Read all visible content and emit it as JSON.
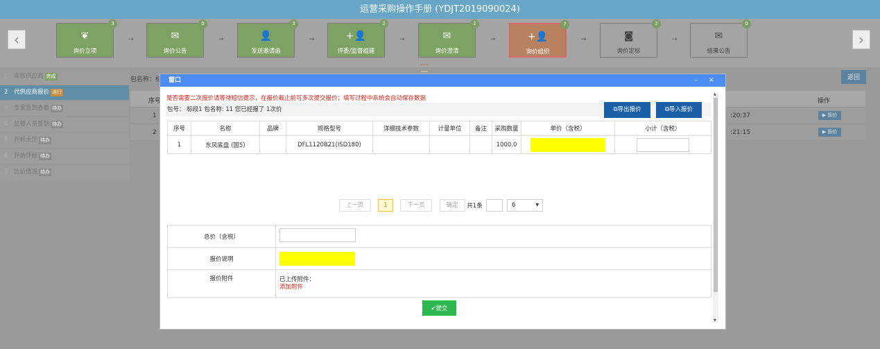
{
  "title": "运营采购操作手册 (YDJT2019090024)",
  "nav": {
    "prev_arrow": "‹",
    "next_arrow": "›",
    "step_separator": "→"
  },
  "steps": [
    {
      "label": "询价立项",
      "badge": "3",
      "color": "#7ea164",
      "icon": "leaf-icon",
      "glyph": "❦"
    },
    {
      "label": "询价公告",
      "badge": "0",
      "color": "#7ea164",
      "icon": "envelope-icon",
      "glyph": "✉"
    },
    {
      "label": "发送邀请函",
      "badge": "3",
      "color": "#7ea164",
      "icon": "user-icon",
      "glyph": "👤"
    },
    {
      "label": "评委/监督组建",
      "badge": "2",
      "color": "#7ea164",
      "icon": "user-plus-icon",
      "glyph": "+👤"
    },
    {
      "label": "询价澄清",
      "badge": "2",
      "color": "#7ea164",
      "icon": "envelope-icon",
      "glyph": "✉"
    },
    {
      "label": "询价组织",
      "badge": "7",
      "color": "#b88260",
      "icon": "user-plus-icon",
      "glyph": "+👤",
      "active": true
    },
    {
      "label": "询价定标",
      "badge": "2",
      "color": "#a4a4a4",
      "icon": "camera-icon",
      "glyph": "◙"
    },
    {
      "label": "结果公告",
      "badge": "0",
      "color": "#a4a4a4",
      "icon": "envelope-icon",
      "glyph": "✉"
    }
  ],
  "sidebar": [
    {
      "num": "1",
      "label": "审核供应商",
      "status": "完成",
      "status_color": "#7ea164"
    },
    {
      "num": "2",
      "label": "代供应商报价",
      "status": "进行",
      "status_color": "#c88a3a",
      "active": true
    },
    {
      "num": "3",
      "label": "专家签到查看",
      "status": "待办"
    },
    {
      "num": "4",
      "label": "监督人员签到",
      "status": "待办"
    },
    {
      "num": "5",
      "label": "开标大厅",
      "status": "待办"
    },
    {
      "num": "6",
      "label": "开始评标",
      "status": "待办"
    },
    {
      "num": "7",
      "label": "比价情况",
      "status": "待办"
    }
  ],
  "background": {
    "package_label": "包名称：标",
    "back_button": "返回",
    "header_no": "序号",
    "header_op": "操作",
    "rows": [
      {
        "no": "1",
        "time": ":20:37",
        "op": "▶ 报价"
      },
      {
        "no": "2",
        "time": ":21:15",
        "op": "▶ 报价"
      }
    ]
  },
  "dialog": {
    "title": "窗口",
    "minimize": "–",
    "close": "×",
    "warning": "是否需要二次报价请等待短信提示，在报价截止前可多次提交报价；填写过程中系统会自动保存数据",
    "info": "包号：   标段1   包名称: 11   您已经报了 1次价",
    "export_button": "⧉导出报价",
    "import_button": "⧉导入报价",
    "columns": [
      "序号",
      "名称",
      "品牌",
      "规格型号",
      "详细技术参数",
      "计量单位",
      "备注",
      "采购数量",
      "单价（含税）",
      "小计（含税）"
    ],
    "items": [
      {
        "no": "1",
        "name": "东风底盘 (国5)",
        "brand": "",
        "model": "DFL1120B21(ISD180)",
        "tech": "",
        "unit": "",
        "remark": "",
        "qty": "1000.0"
      }
    ],
    "pager": {
      "prev": "上一页",
      "current": "1",
      "next": "下一页",
      "confirm": "确定",
      "total": "共1条",
      "page_size": "6",
      "dropdown_arrow": "▼"
    },
    "total_label": "总价（含税）",
    "desc_label": "报价说明",
    "attach_label": "报价附件",
    "attach_uploaded": "已上传附件：",
    "attach_add": "添加附件",
    "submit": "✔提交"
  }
}
